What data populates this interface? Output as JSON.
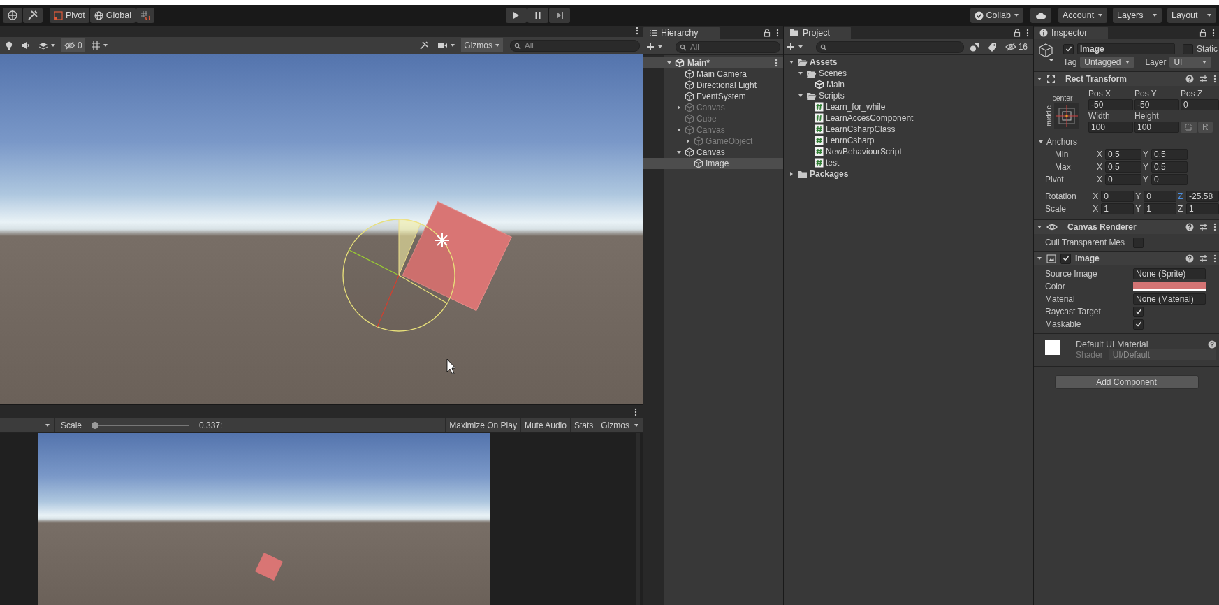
{
  "toolbar": {
    "pivot": "Pivot",
    "global": "Global",
    "collab": "Collab",
    "account": "Account",
    "layers": "Layers",
    "layout": "Layout"
  },
  "scene": {
    "hidden_count": "0",
    "gizmos": "Gizmos",
    "search_placeholder": "All"
  },
  "game": {
    "scale_label": "Scale",
    "scale": {
      "level": 0
    },
    "scale_value": "0.337:",
    "buttons": [
      "Maximize On Play",
      "Mute Audio",
      "Stats"
    ],
    "gizmos": "Gizmos"
  },
  "hierarchy": {
    "title": "Hierarchy",
    "search_placeholder": "All",
    "scene": "Main*",
    "items": [
      {
        "label": "Main Camera",
        "disabled": false,
        "selected": false
      },
      {
        "label": "Directional Light",
        "disabled": false,
        "selected": false
      },
      {
        "label": "EventSystem",
        "disabled": false,
        "selected": false
      },
      {
        "label": "Canvas",
        "disabled": true,
        "selected": false,
        "expanded": false
      },
      {
        "label": "Cube",
        "disabled": true,
        "selected": false
      },
      {
        "label": "Canvas",
        "disabled": true,
        "selected": false,
        "expanded": true,
        "children": [
          {
            "label": "GameObject",
            "disabled": true,
            "selected": false,
            "expanded": false
          }
        ]
      },
      {
        "label": "Canvas",
        "disabled": false,
        "selected": false,
        "expanded": true,
        "children": [
          {
            "label": "Image",
            "disabled": false,
            "selected": true
          }
        ]
      }
    ]
  },
  "project": {
    "title": "Project",
    "hidden_count": "16",
    "tree": [
      {
        "label": "Assets",
        "kind": "folder",
        "expanded": true,
        "children": [
          {
            "label": "Scenes",
            "kind": "folder",
            "expanded": true,
            "children": [
              {
                "label": "Main",
                "kind": "scene"
              }
            ]
          },
          {
            "label": "Scripts",
            "kind": "folder",
            "expanded": true,
            "children": [
              {
                "label": "Learn_for_while",
                "kind": "script"
              },
              {
                "label": "LearnAccesComponent",
                "kind": "script"
              },
              {
                "label": "LearnCsharpClass",
                "kind": "script"
              },
              {
                "label": "LenrnCsharp",
                "kind": "script"
              },
              {
                "label": "NewBehaviourScript",
                "kind": "script"
              },
              {
                "label": "test",
                "kind": "script"
              }
            ]
          }
        ]
      },
      {
        "label": "Packages",
        "kind": "folder",
        "expanded": false
      }
    ]
  },
  "inspector": {
    "title": "Inspector",
    "object": {
      "active": true,
      "name": "Image",
      "static": false,
      "static_label": "Static",
      "tag_label": "Tag",
      "tag": "Untagged",
      "layer_label": "Layer",
      "layer": "UI"
    },
    "rect_transform": {
      "title": "Rect Transform",
      "anchor_h": "center",
      "anchor_v": "middle",
      "fields": [
        {
          "label": "Pos X",
          "value": "-50"
        },
        {
          "label": "Pos Y",
          "value": "-50"
        },
        {
          "label": "Pos Z",
          "value": "0"
        },
        {
          "label": "Width",
          "value": "100"
        },
        {
          "label": "Height",
          "value": "100"
        }
      ],
      "r_button": "R",
      "anchors_label": "Anchors",
      "anchors_expanded": true,
      "anchor_rows": [
        {
          "label": "Min",
          "axes": [
            {
              "axis": "X",
              "value": "0.5"
            },
            {
              "axis": "Y",
              "value": "0.5"
            }
          ]
        },
        {
          "label": "Max",
          "axes": [
            {
              "axis": "X",
              "value": "0.5"
            },
            {
              "axis": "Y",
              "value": "0.5"
            }
          ]
        }
      ],
      "rows": [
        {
          "label": "Pivot",
          "axes": [
            {
              "axis": "X",
              "value": "0",
              "highlighted": false
            },
            {
              "axis": "Y",
              "value": "0",
              "highlighted": false
            }
          ]
        },
        {
          "label": "Rotation",
          "axes": [
            {
              "axis": "X",
              "value": "0",
              "highlighted": false
            },
            {
              "axis": "Y",
              "value": "0",
              "highlighted": false
            },
            {
              "axis": "Z",
              "value": "-25.58",
              "highlighted": true
            }
          ]
        },
        {
          "label": "Scale",
          "axes": [
            {
              "axis": "X",
              "value": "1",
              "highlighted": false
            },
            {
              "axis": "Y",
              "value": "1",
              "highlighted": false
            },
            {
              "axis": "Z",
              "value": "1",
              "highlighted": false
            }
          ]
        }
      ]
    },
    "canvas_renderer": {
      "title": "Canvas Renderer",
      "props": [
        {
          "label": "Cull Transparent Mes",
          "kind": "checkbox",
          "checked": false
        }
      ]
    },
    "image": {
      "title": "Image",
      "enabled": true,
      "props": [
        {
          "label": "Source Image",
          "kind": "object",
          "value": "None (Sprite)"
        },
        {
          "label": "Color",
          "kind": "color",
          "color": "#d47474"
        },
        {
          "label": "Material",
          "kind": "object",
          "value": "None (Material)"
        },
        {
          "label": "Raycast Target",
          "kind": "checkbox",
          "checked": true
        },
        {
          "label": "Maskable",
          "kind": "checkbox",
          "checked": true
        }
      ]
    },
    "material": {
      "name": "Default UI Material",
      "shader_label": "Shader",
      "shader": "UI/Default"
    },
    "add_component": "Add Component"
  }
}
